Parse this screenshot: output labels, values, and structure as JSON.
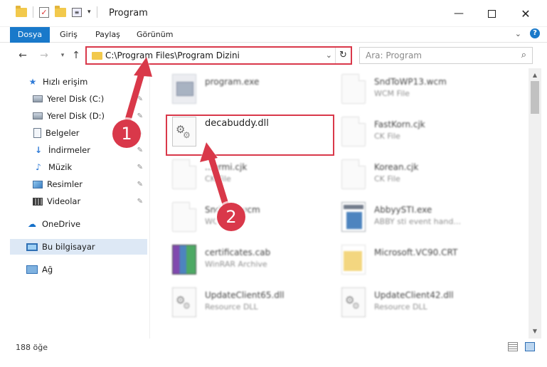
{
  "window": {
    "title": "Program",
    "minimize_glyph": "—",
    "close_glyph": "✕"
  },
  "ribbon": {
    "tabs": [
      "Dosya",
      "Giriş",
      "Paylaş",
      "Görünüm"
    ],
    "expand_glyph": "⌄",
    "help_glyph": "?"
  },
  "nav": {
    "back_glyph": "←",
    "forward_glyph": "→",
    "recent_glyph": "▾",
    "up_glyph": "↑"
  },
  "address": {
    "path": "C:\\Program Files\\Program Dizini",
    "dropdown_glyph": "⌄",
    "refresh_glyph": "↻"
  },
  "search": {
    "placeholder": "Ara: Program",
    "icon_glyph": "⌕"
  },
  "sidebar": {
    "items": [
      {
        "label": "Hızlı erişim",
        "icon": "star-icon",
        "pinned": false
      },
      {
        "label": "Yerel Disk (C:)",
        "icon": "disk-icon",
        "pinned": true
      },
      {
        "label": "Yerel Disk (D:)",
        "icon": "disk-icon",
        "pinned": true
      },
      {
        "label": "Belgeler",
        "icon": "documents-icon",
        "pinned": true
      },
      {
        "label": "İndirmeler",
        "icon": "download-icon",
        "pinned": true
      },
      {
        "label": "Müzik",
        "icon": "music-icon",
        "pinned": true
      },
      {
        "label": "Resimler",
        "icon": "pictures-icon",
        "pinned": true
      },
      {
        "label": "Videolar",
        "icon": "videos-icon",
        "pinned": true
      },
      {
        "label": "OneDrive",
        "icon": "cloud-icon",
        "pinned": false
      },
      {
        "label": "Bu bilgisayar",
        "icon": "computer-icon",
        "pinned": false,
        "selected": true
      },
      {
        "label": "Ağ",
        "icon": "network-icon",
        "pinned": false
      }
    ],
    "pin_glyph": "📌"
  },
  "files": {
    "left": [
      {
        "name": "program.exe",
        "type": "",
        "icon": "exe-icon"
      },
      {
        "name": "decabuddy.dll",
        "type": "",
        "icon": "dll-icon"
      },
      {
        "name": "...ermi.cjk",
        "type": "CK File",
        "icon": "document-icon"
      },
      {
        "name": "Snd....4.wcm",
        "type": "WC...",
        "icon": "document-icon"
      },
      {
        "name": "certificates.cab",
        "type": "WinRAR Archive",
        "icon": "archive-icon"
      },
      {
        "name": "UpdateClient65.dll",
        "type": "Resource DLL",
        "icon": "dll-icon"
      }
    ],
    "right": [
      {
        "name": "SndToWP13.wcm",
        "type": "WCM File",
        "icon": "document-icon"
      },
      {
        "name": "FastKorn.cjk",
        "type": "CK File",
        "icon": "document-icon"
      },
      {
        "name": "Korean.cjk",
        "type": "CK File",
        "icon": "document-icon"
      },
      {
        "name": "AbbyySTI.exe",
        "type": "ABBY sti event hand...",
        "icon": "app-icon"
      },
      {
        "name": "Microsoft.VC90.CRT",
        "type": "",
        "icon": "folder-icon"
      },
      {
        "name": "UpdateClient42.dll",
        "type": "Resource DLL",
        "icon": "dll-icon"
      }
    ]
  },
  "status": {
    "count": "188 öğe"
  },
  "annotations": {
    "step1": "1",
    "step2": "2",
    "highlight_color": "#d9384a"
  },
  "colors": {
    "accent": "#1979ca",
    "highlight": "#d9384a"
  }
}
